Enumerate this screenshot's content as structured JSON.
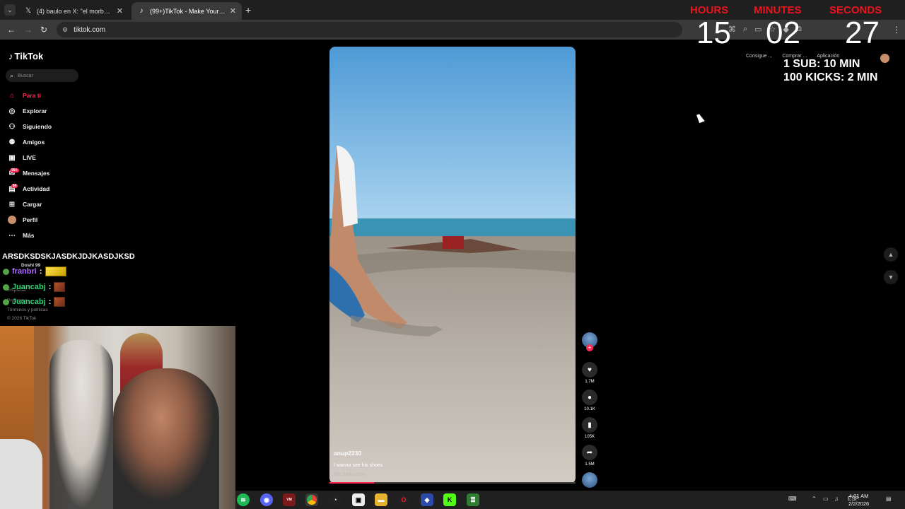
{
  "browser": {
    "tabs": [
      {
        "title": "(4) baulo en X: \"el morboso era",
        "icon": "x-logo-icon"
      },
      {
        "title": "(99+)TikTok - Make Your Day",
        "icon": "tiktok-icon"
      }
    ],
    "url": "tiktok.com",
    "bookmarks": [
      "Consigue ...",
      "Comprar ...",
      "Aplicación"
    ]
  },
  "tiktok": {
    "logo": "TikTok",
    "search_placeholder": "Buscar",
    "nav": [
      {
        "label": "Para ti",
        "icon": "home-icon",
        "active": true
      },
      {
        "label": "Explorar",
        "icon": "compass-icon"
      },
      {
        "label": "Siguiendo",
        "icon": "following-icon"
      },
      {
        "label": "Amigos",
        "icon": "friends-icon"
      },
      {
        "label": "LIVE",
        "icon": "live-icon"
      },
      {
        "label": "Mensajes",
        "icon": "messages-icon",
        "badge": "99+"
      },
      {
        "label": "Actividad",
        "icon": "activity-icon",
        "badge": "54"
      },
      {
        "label": "Cargar",
        "icon": "upload-icon"
      },
      {
        "label": "Perfil",
        "icon": "profile-avatar-icon"
      },
      {
        "label": "Más",
        "icon": "more-icon"
      }
    ],
    "following_user": "Doshi 99",
    "footer": [
      "Empresa",
      "Programa",
      "Términos y políticas",
      "© 2026 TikTok"
    ],
    "video": {
      "author": "anup2230",
      "caption": "I wanna see his shoes",
      "translate": "Ver traducción",
      "progress": 0.18,
      "likes": "1.7M",
      "comments": "10.1K",
      "saves": "105K",
      "shares": "1.5M"
    }
  },
  "chat": {
    "banner": "ARSDKSDSKJASDKJDJKASDJKSD",
    "lines": [
      {
        "user": "franbri",
        "suffix": ":",
        "color": "#b06bff"
      },
      {
        "user": "Juancabj",
        "suffix": ":",
        "color": "#2fd37a"
      },
      {
        "user": "Juancabj",
        "suffix": ":",
        "color": "#2fd37a"
      }
    ]
  },
  "timer": {
    "labels": {
      "hours": "HOURS",
      "minutes": "MINUTES",
      "seconds": "SECONDS"
    },
    "hours": "15",
    "minutes": "02",
    "seconds": "27",
    "rules": [
      "1 SUB: 10 MIN",
      "100 KICKS: 2 MIN"
    ],
    "label_color": "#e8141e"
  },
  "taskbar": {
    "language": "ESP",
    "time": "4:01 AM",
    "date": "2/2/2026"
  }
}
